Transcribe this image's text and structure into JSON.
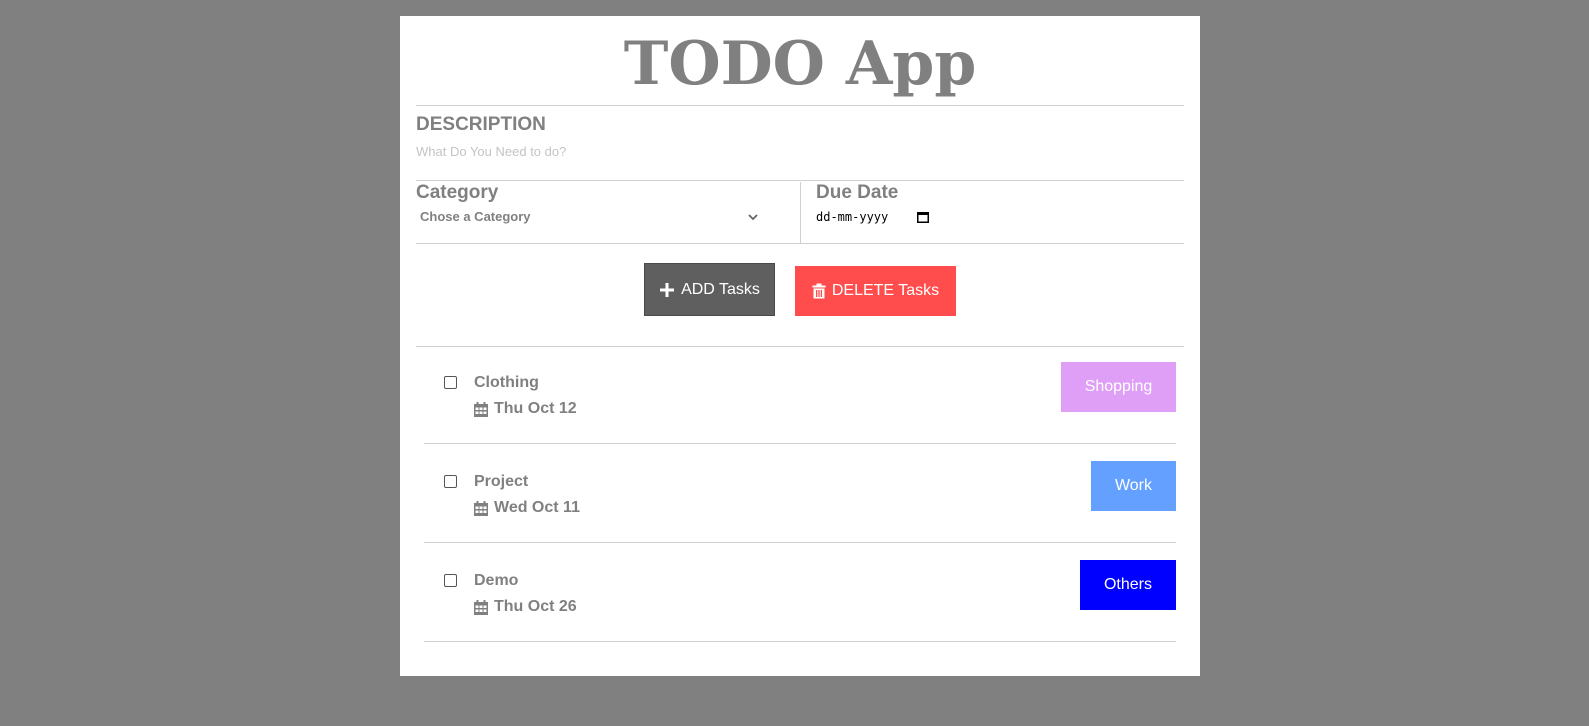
{
  "app": {
    "title": "TODO App"
  },
  "form": {
    "description_label": "DESCRIPTION",
    "description_placeholder": "What Do You Need to do?",
    "description_value": "",
    "category_label": "Category",
    "category_selected": "Chose a Category",
    "due_date_label": "Due Date",
    "due_date_placeholder": "dd-mm-yyyy"
  },
  "actions": {
    "add_label": "ADD Tasks",
    "add_icon": "plus-icon",
    "delete_label": "DELETE Tasks",
    "delete_icon": "trash-icon"
  },
  "tasks": [
    {
      "name": "Clothing",
      "date": "Thu Oct 12",
      "category": "Shopping",
      "category_color": "#df9ff7",
      "checked": false
    },
    {
      "name": "Project",
      "date": "Wed Oct 11",
      "category": "Work",
      "category_color": "#64a0ff",
      "checked": false
    },
    {
      "name": "Demo",
      "date": "Thu Oct 26",
      "category": "Others",
      "category_color": "#0000ff",
      "checked": false
    }
  ],
  "colors": {
    "background": "#808080",
    "card": "#ffffff",
    "text_muted": "#808080",
    "add_button": "#5f5f5f",
    "delete_button": "#ff4c4c"
  }
}
